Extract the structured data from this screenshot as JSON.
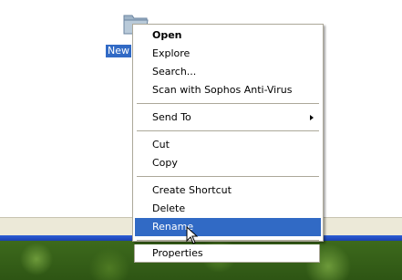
{
  "desktop": {
    "folder_label": "New",
    "folder_icon": "folder-icon"
  },
  "context_menu": {
    "items": [
      {
        "label": "Open",
        "bold": true
      },
      {
        "label": "Explore"
      },
      {
        "label": "Search..."
      },
      {
        "label": "Scan with Sophos Anti-Virus"
      },
      {
        "label": "Send To",
        "submenu": true
      },
      {
        "label": "Cut"
      },
      {
        "label": "Copy"
      },
      {
        "label": "Create Shortcut"
      },
      {
        "label": "Delete"
      },
      {
        "label": "Rename",
        "selected": true
      },
      {
        "label": "Properties"
      }
    ]
  },
  "colors": {
    "selection": "#316ac5",
    "taskbar_blue": "#2d5fd6"
  }
}
